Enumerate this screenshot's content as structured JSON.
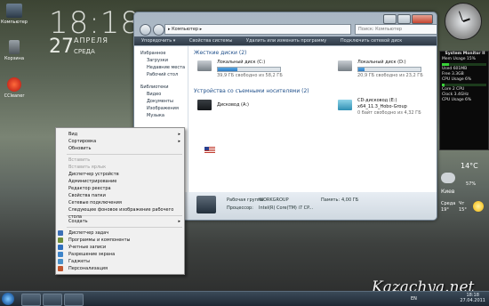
{
  "desktop": {
    "clock_time": "18:18",
    "clock_day": "27",
    "clock_month": "АПРЕЛЯ",
    "clock_weekday": "СРЕДА",
    "icons": [
      {
        "label": "Компьютер"
      },
      {
        "label": "Корзина"
      },
      {
        "label": "CCleaner"
      }
    ]
  },
  "explorer": {
    "address": "▸ Компьютер ▸",
    "search_placeholder": "Поиск: Компьютер",
    "toolbar": [
      "Упорядочить ▾",
      "Свойства системы",
      "Удалить или изменить программу",
      "Подключить сетевой диск"
    ],
    "nav": {
      "favorites": "Избранное",
      "fav_items": [
        "Загрузки",
        "Недавние места",
        "Рабочий стол"
      ],
      "libraries": "Библиотеки",
      "lib_items": [
        "Видео",
        "Документы",
        "Изображения",
        "Музыка"
      ]
    },
    "section_hdd": "Жесткие диски (2)",
    "drives": [
      {
        "name": "Локальный диск (C:)",
        "free": "39,9 ГБ свободно из 58,2 ГБ",
        "used": 0.31
      },
      {
        "name": "Локальный диск (D:)",
        "free": "20,9 ГБ свободно из 23,2 ГБ",
        "used": 0.1
      }
    ],
    "section_removable": "Устройства со съемными носителями (2)",
    "removable": [
      {
        "name": "Дисковод (A:)",
        "line2": ""
      },
      {
        "name": "CD-дисковод (E:)",
        "line2": "x64_11.3_Hobo-Group",
        "line3": "0 байт свободно из 4,32 ГБ"
      }
    ],
    "details": {
      "workgroup_label": "Рабочая группа:",
      "workgroup": "WORKGROUP",
      "memory_label": "Память:",
      "memory": "4,00 ГБ",
      "cpu_label": "Процессор:",
      "cpu": "Intel(R) Core(TM) i7 CP..."
    }
  },
  "context_menu": {
    "items": [
      {
        "label": "Вид",
        "arrow": "▸",
        "disabled": false
      },
      {
        "label": "Сортировка",
        "arrow": "▸",
        "disabled": false
      },
      {
        "label": "Обновить",
        "arrow": "",
        "disabled": false
      },
      {
        "sep": true
      },
      {
        "label": "Вставить",
        "arrow": "",
        "disabled": true
      },
      {
        "label": "Вставить ярлык",
        "arrow": "",
        "disabled": true
      },
      {
        "label": "Диспетчер устройств",
        "arrow": "",
        "disabled": false
      },
      {
        "label": "Администрирование",
        "arrow": "",
        "disabled": false
      },
      {
        "label": "Редактор реестра",
        "arrow": "",
        "disabled": false
      },
      {
        "label": "Свойства папки",
        "arrow": "",
        "disabled": false
      },
      {
        "label": "Сетевые подключения",
        "arrow": "",
        "disabled": false
      },
      {
        "label": "Следующее фоновое изображение рабочего стола",
        "arrow": "",
        "disabled": false
      },
      {
        "sep": true
      },
      {
        "label": "Создать",
        "arrow": "▸",
        "disabled": false
      },
      {
        "sep": true
      },
      {
        "label": "Диспетчер задач",
        "arrow": "",
        "disabled": false,
        "icon": "#3b6fb6"
      },
      {
        "label": "Программы и компоненты",
        "arrow": "",
        "disabled": false,
        "icon": "#6f8f3a"
      },
      {
        "label": "Учетные записи",
        "arrow": "",
        "disabled": false,
        "icon": "#2f6fbd"
      },
      {
        "label": "Разрешение экрана",
        "arrow": "",
        "disabled": false,
        "icon": "#3d84c9"
      },
      {
        "label": "Гаджеты",
        "arrow": "",
        "disabled": false,
        "icon": "#4a90c8"
      },
      {
        "label": "Персонализация",
        "arrow": "",
        "disabled": false,
        "icon": "#c0562e"
      }
    ]
  },
  "sysmon": {
    "title": "System Monitor II",
    "rows": [
      "Mem Usage   15%",
      "Used  601MB",
      "Free  3.3GB",
      "CPU Usage  6%",
      "Core  2  CPU",
      "Clock  3.4GHz",
      "CPU Usage  6%"
    ]
  },
  "weather": {
    "temp": "14°C",
    "city": "Киев",
    "hum": "57%",
    "day1": "Среда",
    "day1_t": "19°",
    "day2": "Чт",
    "day2_t": "15°"
  },
  "taskbar": {
    "lang": "EN",
    "time": "18:18",
    "date": "27.04.2011"
  },
  "watermark": "Kazachya.net"
}
